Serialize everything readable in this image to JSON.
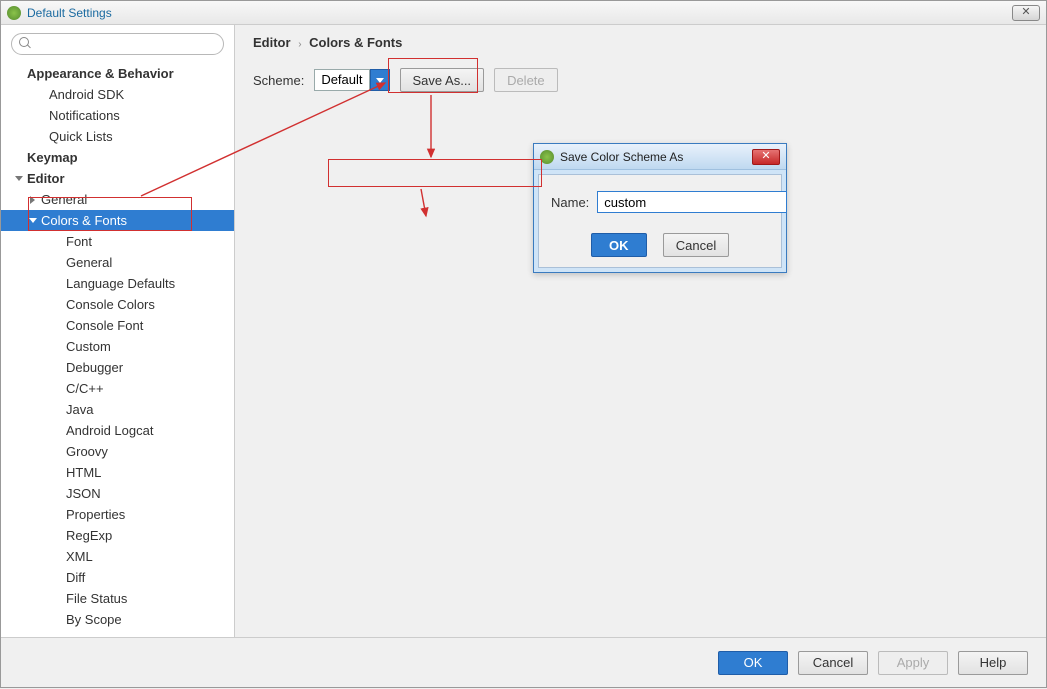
{
  "window": {
    "title": "Default Settings",
    "close_glyph": "✕"
  },
  "search": {
    "placeholder": ""
  },
  "tree": {
    "appearance": "Appearance & Behavior",
    "android_sdk": "Android SDK",
    "notifications": "Notifications",
    "quick_lists": "Quick Lists",
    "keymap": "Keymap",
    "editor": "Editor",
    "general": "General",
    "colors_fonts": "Colors & Fonts",
    "font": "Font",
    "cf_general": "General",
    "lang_defaults": "Language Defaults",
    "console_colors": "Console Colors",
    "console_font": "Console Font",
    "custom": "Custom",
    "debugger": "Debugger",
    "ccpp": "C/C++",
    "java": "Java",
    "android_logcat": "Android Logcat",
    "groovy": "Groovy",
    "html": "HTML",
    "json": "JSON",
    "properties": "Properties",
    "regexp": "RegExp",
    "xml": "XML",
    "diff": "Diff",
    "file_status": "File Status",
    "by_scope": "By Scope"
  },
  "breadcrumb": {
    "root": "Editor",
    "leaf": "Colors & Fonts"
  },
  "scheme": {
    "label": "Scheme:",
    "value": "Default",
    "save_as": "Save As...",
    "delete": "Delete"
  },
  "dialog": {
    "title": "Save Color Scheme As",
    "name_label": "Name:",
    "name_value": "custom",
    "ok": "OK",
    "cancel": "Cancel",
    "close_glyph": "✕"
  },
  "footer": {
    "ok": "OK",
    "cancel": "Cancel",
    "apply": "Apply",
    "help": "Help"
  }
}
